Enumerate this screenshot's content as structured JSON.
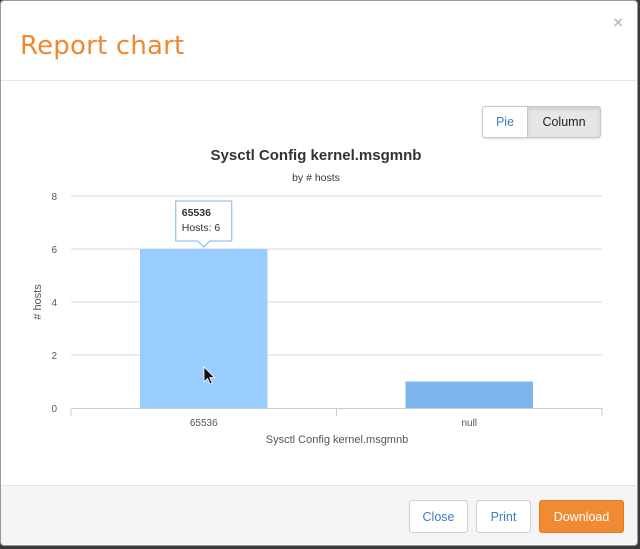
{
  "modal": {
    "title": "Report chart",
    "close_glyph": "×"
  },
  "toggle": {
    "pie_label": "Pie",
    "column_label": "Column",
    "active": "Column"
  },
  "footer": {
    "close_label": "Close",
    "print_label": "Print",
    "download_label": "Download"
  },
  "colors": {
    "accent": "#ee8a2e",
    "bar_hover": "#99ccff",
    "bar": "#7cb5ec",
    "link": "#3c7fc0"
  },
  "chart_data": {
    "type": "bar",
    "title": "Sysctl Config kernel.msgmnb",
    "subtitle": "by # hosts",
    "xlabel": "Sysctl Config kernel.msgmnb",
    "ylabel": "# hosts",
    "categories": [
      "65536",
      "null"
    ],
    "values": [
      6,
      1
    ],
    "ylim": [
      0,
      8
    ],
    "yticks": [
      0,
      2,
      4,
      6,
      8
    ],
    "grid": true,
    "hovered_index": 0,
    "tooltip": {
      "category": "65536",
      "label": "Hosts",
      "value": "6"
    }
  }
}
